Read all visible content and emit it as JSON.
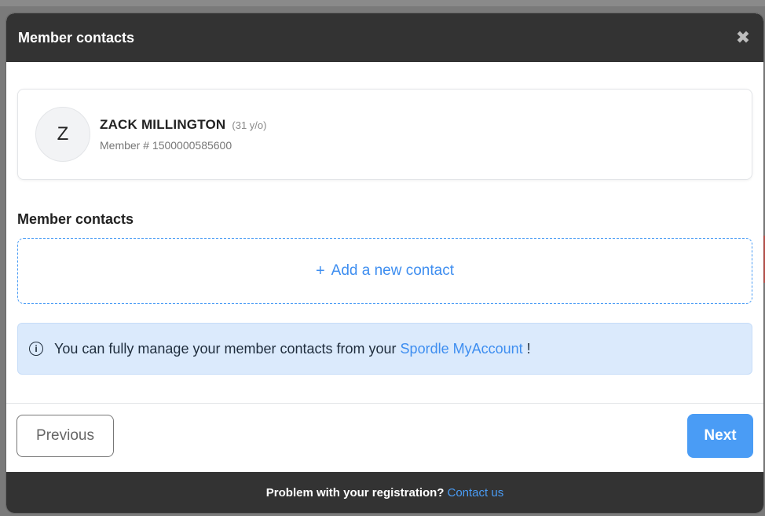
{
  "modal": {
    "title": "Member contacts",
    "close_icon": "close-icon"
  },
  "member": {
    "initial": "Z",
    "name": "ZACK MILLINGTON",
    "age": "(31 y/o)",
    "number": "Member # 1500000585600"
  },
  "contacts": {
    "section_title": "Member contacts",
    "add_plus": "+",
    "add_label": "Add a new contact"
  },
  "info": {
    "icon": "info-icon",
    "icon_glyph": "i",
    "text": "You can fully manage your member contacts from your",
    "link": "Spordle MyAccount",
    "suffix": "!"
  },
  "footer": {
    "previous_label": "Previous",
    "next_label": "Next"
  },
  "bottom_bar": {
    "text": "Problem with your registration?",
    "link": "Contact us"
  },
  "colors": {
    "header_bg": "#333333",
    "accent": "#4a9cf5",
    "alert_bg": "#dbeafc"
  }
}
